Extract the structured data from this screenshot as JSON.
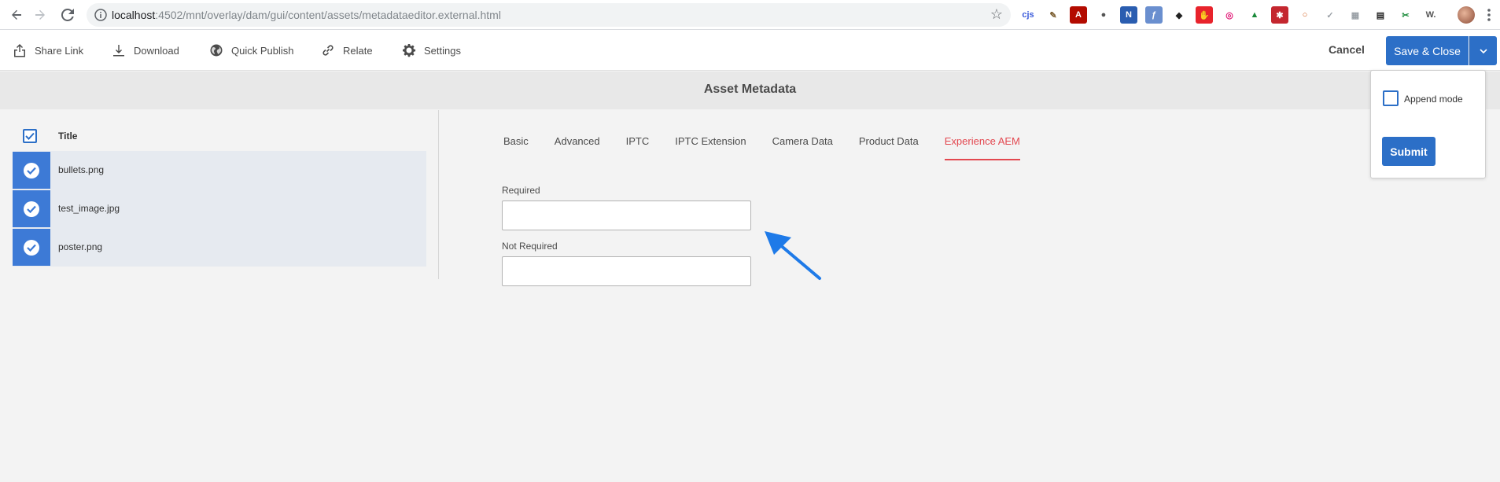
{
  "browser": {
    "url_host": "localhost",
    "url_path": ":4502/mnt/overlay/dam/gui/content/assets/metadataeditor.external.html",
    "extensions": [
      {
        "name": "cjs-icon",
        "glyph": "cjs",
        "color": "#3b5bdb",
        "bg": "#ffffff"
      },
      {
        "name": "pen-icon",
        "glyph": "✎",
        "color": "#7a5c2e",
        "bg": "#ffffff"
      },
      {
        "name": "acrobat-icon",
        "glyph": "A",
        "color": "#ffffff",
        "bg": "#b30b00"
      },
      {
        "name": "circle-icon",
        "glyph": "●",
        "color": "#555555",
        "bg": "#ffffff"
      },
      {
        "name": "new-badge-icon",
        "glyph": "N",
        "color": "#ffffff",
        "bg": "#2a5db0"
      },
      {
        "name": "feather-icon",
        "glyph": "ƒ",
        "color": "#ffffff",
        "bg": "#6a8fcf"
      },
      {
        "name": "spy-icon",
        "glyph": "◆",
        "color": "#222222",
        "bg": "#ffffff"
      },
      {
        "name": "stop-hand-icon",
        "glyph": "✋",
        "color": "#ffffff",
        "bg": "#e8232c"
      },
      {
        "name": "target-icon",
        "glyph": "◎",
        "color": "#e21d79",
        "bg": "#ffffff"
      },
      {
        "name": "drive-icon",
        "glyph": "▲",
        "color": "#1a8a3a",
        "bg": "#ffffff"
      },
      {
        "name": "red-square-icon",
        "glyph": "✱",
        "color": "#ffffff",
        "bg": "#c4272f"
      },
      {
        "name": "ring-icon",
        "glyph": "○",
        "color": "#d15a1a",
        "bg": "#ffffff"
      },
      {
        "name": "feather-grey-icon",
        "glyph": "✓",
        "color": "#9aa0a6",
        "bg": "#ffffff"
      },
      {
        "name": "grid-grey-icon",
        "glyph": "▦",
        "color": "#9aa0a6",
        "bg": "#ffffff"
      },
      {
        "name": "calendar-icon",
        "glyph": "▤",
        "color": "#222222",
        "bg": "#ffffff"
      },
      {
        "name": "leaf-icon",
        "glyph": "✂",
        "color": "#1a8a3a",
        "bg": "#ffffff"
      },
      {
        "name": "w-icon",
        "glyph": "W.",
        "color": "#555555",
        "bg": "#ffffff"
      }
    ]
  },
  "actionbar": {
    "share_link": "Share Link",
    "download": "Download",
    "quick_publish": "Quick Publish",
    "relate": "Relate",
    "settings": "Settings",
    "cancel": "Cancel",
    "save_close": "Save & Close"
  },
  "page": {
    "title": "Asset Metadata"
  },
  "assets": {
    "column_title": "Title",
    "items": [
      {
        "name": "bullets.png"
      },
      {
        "name": "test_image.jpg"
      },
      {
        "name": "poster.png"
      }
    ]
  },
  "tabs": [
    {
      "label": "Basic",
      "active": false
    },
    {
      "label": "Advanced",
      "active": false
    },
    {
      "label": "IPTC",
      "active": false
    },
    {
      "label": "IPTC Extension",
      "active": false
    },
    {
      "label": "Camera Data",
      "active": false
    },
    {
      "label": "Product Data",
      "active": false
    },
    {
      "label": "Experience AEM",
      "active": true
    }
  ],
  "form": {
    "required_label": "Required",
    "required_value": "",
    "not_required_label": "Not Required",
    "not_required_value": ""
  },
  "popover": {
    "append_mode_label": "Append mode",
    "append_mode_checked": false,
    "submit": "Submit"
  },
  "colors": {
    "accent": "#2c6fc7",
    "active_tab": "#e34850",
    "annotation_arrow": "#1e7ae8"
  }
}
